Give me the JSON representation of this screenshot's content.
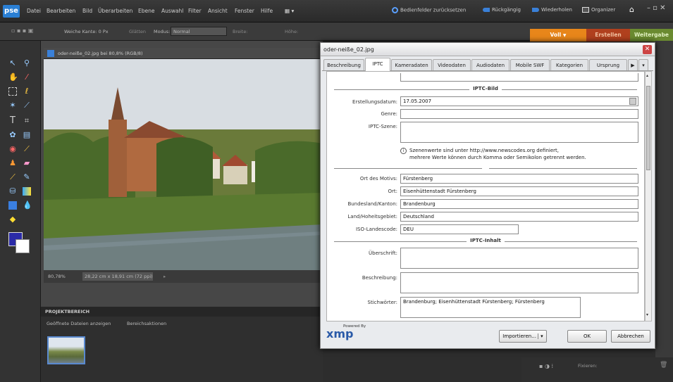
{
  "app": {
    "logo": "pse"
  },
  "menu": [
    "Datei",
    "Bearbeiten",
    "Bild",
    "Überarbeiten",
    "Ebene",
    "Auswahl",
    "Filter",
    "Ansicht",
    "Fenster",
    "Hilfe"
  ],
  "top_actions": {
    "reset": "Bedienfelder zurücksetzen",
    "undo": "Rückgängig",
    "redo": "Wiederholen",
    "organizer": "Organizer"
  },
  "options": {
    "feather": "Weiche Kante: 0 Px",
    "smooth": "Glätten",
    "mode_label": "Modus:",
    "mode_value": "Normal",
    "width": "Breite:",
    "height": "Höhe:"
  },
  "mode_tabs": {
    "full": "Voll",
    "create": "Erstellen",
    "share": "Weitergabe"
  },
  "document": {
    "tab": "oder-neiße_02.jpg bei 80,8% (RGB/8)",
    "zoom": "80,78%",
    "size": "28,22 cm x 18,91 cm (72 ppi)"
  },
  "project": {
    "header": "PROJEKTBEREICH",
    "show_open": "Geöffnete Dateien anzeigen",
    "actions": "Bereichsaktionen"
  },
  "bottom_right": {
    "filter": "Fixieren:"
  },
  "dialog": {
    "title": "oder-neiße_02.jpg",
    "tabs": [
      "Beschreibung",
      "IPTC",
      "Kameradaten",
      "Videodaten",
      "Audiodaten",
      "Mobile SWF",
      "Kategorien",
      "Ursprung"
    ],
    "active_tab": "IPTC",
    "section_image": "IPTC-Bild",
    "section_content": "IPTC-Inhalt",
    "fields": {
      "created_label": "Erstellungsdatum:",
      "created_value": "17.05.2007",
      "genre_label": "Genre:",
      "genre_value": "",
      "scene_label": "IPTC-Szene:",
      "scene_value": "",
      "scene_note_1": "Szenenwerte sind unter http://www.newscodes.org definiert,",
      "scene_note_2": "mehrere Werte können durch Komma oder Semikolon getrennt werden.",
      "location_label": "Ort des Motivs:",
      "location_value": "Fürstenberg",
      "city_label": "Ort:",
      "city_value": "Eisenhüttenstadt Fürstenberg",
      "state_label": "Bundesland/Kanton:",
      "state_value": "Brandenburg",
      "country_label": "Land/Hoheitsgebiet:",
      "country_value": "Deutschland",
      "iso_label": "ISO-Landescode:",
      "iso_value": "DEU",
      "headline_label": "Überschrift:",
      "headline_value": "",
      "description_label": "Beschreibung:",
      "description_value": "",
      "keywords_label": "Stichwörter:",
      "keywords_value": "Brandenburg; Eisenhüttenstadt Fürstenberg; Fürstenberg"
    },
    "powered_by": "Powered By",
    "xmp_logo": "xmp",
    "buttons": {
      "import": "Importieren...",
      "ok": "OK",
      "cancel": "Abbrechen"
    }
  },
  "colors": {
    "accent_orange": "#e8861a",
    "create_tab": "#b0401e",
    "share_tab": "#6a8a30",
    "dialog_bg": "#e9ebee"
  }
}
